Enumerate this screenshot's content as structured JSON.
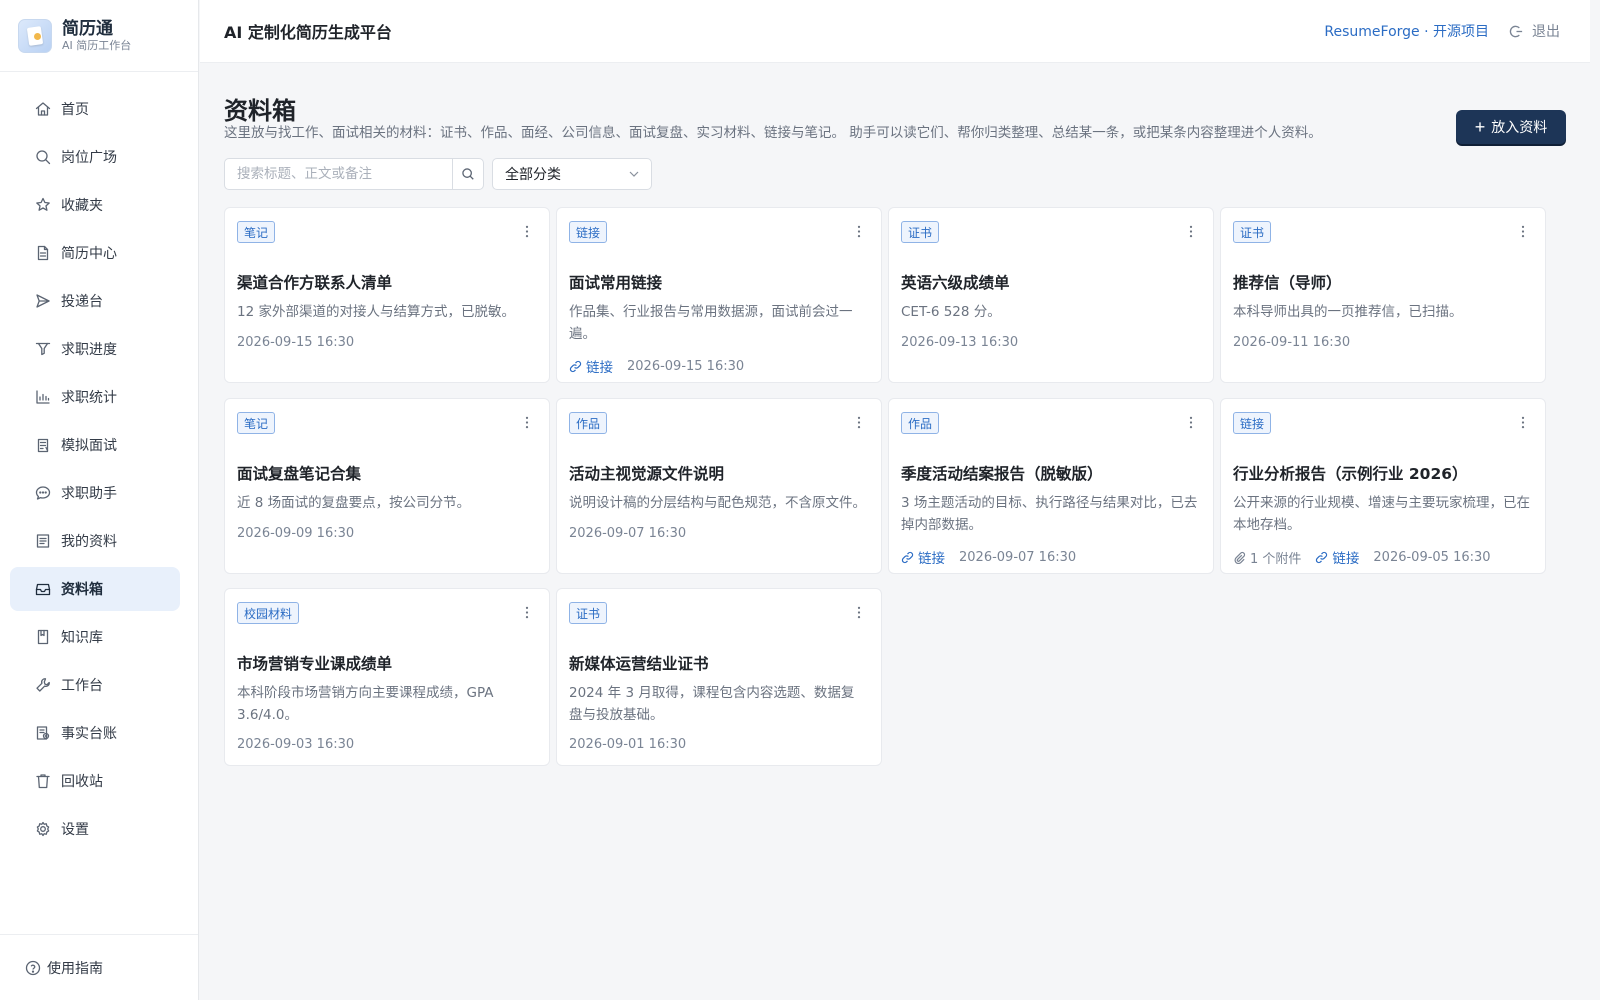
{
  "brand": {
    "name": "简历通",
    "subtitle": "AI 简历工作台"
  },
  "sidebar": {
    "items": [
      {
        "label": "首页",
        "icon": "home-icon"
      },
      {
        "label": "岗位广场",
        "icon": "search-icon"
      },
      {
        "label": "收藏夹",
        "icon": "star-icon"
      },
      {
        "label": "简历中心",
        "icon": "document-icon"
      },
      {
        "label": "投递台",
        "icon": "send-icon"
      },
      {
        "label": "求职进度",
        "icon": "filter-icon"
      },
      {
        "label": "求职统计",
        "icon": "bar-chart-icon"
      },
      {
        "label": "模拟面试",
        "icon": "clipboard-icon"
      },
      {
        "label": "求职助手",
        "icon": "chat-icon"
      },
      {
        "label": "我的资料",
        "icon": "profile-list-icon"
      },
      {
        "label": "资料箱",
        "icon": "inbox-icon",
        "active": true
      },
      {
        "label": "知识库",
        "icon": "book-icon"
      },
      {
        "label": "工作台",
        "icon": "wrench-icon"
      },
      {
        "label": "事实台账",
        "icon": "ledger-icon"
      },
      {
        "label": "回收站",
        "icon": "trash-icon"
      },
      {
        "label": "设置",
        "icon": "gear-icon"
      }
    ],
    "footer_label": "使用指南"
  },
  "header": {
    "title": "AI 定制化简历生成平台",
    "link_label": "ResumeForge · 开源项目",
    "logout_label": "退出"
  },
  "main": {
    "title": "资料箱",
    "description": "这里放与找工作、面试相关的材料：证书、作品、面经、公司信息、面试复盘、实习材料、链接与笔记。 助手可以读它们、帮你归类整理、总结某一条，或把某条内容整理进个人资料。",
    "add_button_label": "放入资料",
    "search_placeholder": "搜索标题、正文或备注",
    "category_select": "全部分类"
  },
  "cards": [
    {
      "tag": "笔记",
      "title": "渠道合作方联系人清单",
      "desc": "12 家外部渠道的对接人与结算方式，已脱敏。",
      "date": "2026-09-15 16:30",
      "link": null,
      "attachments": null
    },
    {
      "tag": "链接",
      "title": "面试常用链接",
      "desc": "作品集、行业报告与常用数据源，面试前会过一遍。",
      "date": "2026-09-15 16:30",
      "link": "链接",
      "attachments": null
    },
    {
      "tag": "证书",
      "title": "英语六级成绩单",
      "desc": "CET-6 528 分。",
      "date": "2026-09-13 16:30",
      "link": null,
      "attachments": null
    },
    {
      "tag": "证书",
      "title": "推荐信（导师）",
      "desc": "本科导师出具的一页推荐信，已扫描。",
      "date": "2026-09-11 16:30",
      "link": null,
      "attachments": null
    },
    {
      "tag": "笔记",
      "title": "面试复盘笔记合集",
      "desc": "近 8 场面试的复盘要点，按公司分节。",
      "date": "2026-09-09 16:30",
      "link": null,
      "attachments": null
    },
    {
      "tag": "作品",
      "title": "活动主视觉源文件说明",
      "desc": "说明设计稿的分层结构与配色规范，不含原文件。",
      "date": "2026-09-07 16:30",
      "link": null,
      "attachments": null
    },
    {
      "tag": "作品",
      "title": "季度活动结案报告（脱敏版）",
      "desc": "3 场主题活动的目标、执行路径与结果对比，已去掉内部数据。",
      "date": "2026-09-07 16:30",
      "link": "链接",
      "attachments": null
    },
    {
      "tag": "链接",
      "title": "行业分析报告（示例行业 2026）",
      "desc": "公开来源的行业规模、增速与主要玩家梳理，已在本地存档。",
      "date": "2026-09-05 16:30",
      "link": "链接",
      "attachments": "1 个附件"
    },
    {
      "tag": "校园材料",
      "title": "市场营销专业课成绩单",
      "desc": "本科阶段市场营销方向主要课程成绩，GPA 3.6/4.0。",
      "date": "2026-09-03 16:30",
      "link": null,
      "attachments": null
    },
    {
      "tag": "证书",
      "title": "新媒体运营结业证书",
      "desc": "2024 年 3 月取得，课程包含内容选题、数据复盘与投放基础。",
      "date": "2026-09-01 16:30",
      "link": null,
      "attachments": null
    }
  ],
  "colors": {
    "accent": "#2b6cc4",
    "primary_button": "#1d3557",
    "active_nav_bg": "#e8f0fb",
    "tag_bg": "#eef4fd",
    "tag_border": "#8fb3e6"
  }
}
